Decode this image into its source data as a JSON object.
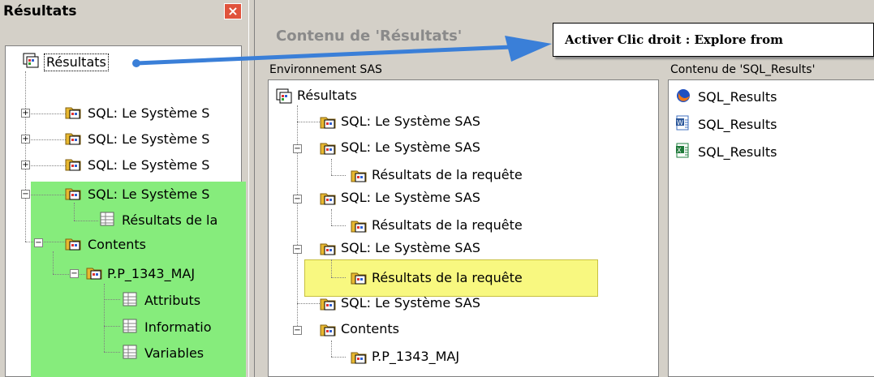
{
  "left": {
    "title": "Résultats",
    "close": "×",
    "items": [
      {
        "label": "Résultats"
      },
      {
        "label": "SQL:  Le Système S"
      },
      {
        "label": "SQL:  Le Système S"
      },
      {
        "label": "SQL:  Le Système S"
      },
      {
        "label": "SQL:  Le Système S"
      },
      {
        "label": "SQL:  Le Système S"
      },
      {
        "label": "Résultats de la"
      },
      {
        "label": "Contents"
      },
      {
        "label": "P.P_1343_MAJ"
      },
      {
        "label": "Attributs"
      },
      {
        "label": "Informatio"
      },
      {
        "label": "Variables"
      }
    ]
  },
  "right": {
    "title": "Contenu de 'Résultats'",
    "tooltip": "Activer Clic droit : Explore from",
    "env_label": "Environnement SAS",
    "contenu_label": "Contenu de 'SQL_Results'",
    "env_items": [
      {
        "label": "Résultats"
      },
      {
        "label": "SQL:  Le Système SAS"
      },
      {
        "label": "SQL:  Le Système SAS"
      },
      {
        "label": "Résultats de la requête"
      },
      {
        "label": "SQL:  Le Système SAS"
      },
      {
        "label": "Résultats de la requête"
      },
      {
        "label": "SQL:  Le Système SAS"
      },
      {
        "label": "Résultats de la requête"
      },
      {
        "label": "SQL:  Le Système SAS"
      },
      {
        "label": "Contents"
      },
      {
        "label": "P.P_1343_MAJ"
      }
    ],
    "contents": [
      {
        "label": "SQL_Results",
        "icon": "firefox-icon"
      },
      {
        "label": "SQL_Results",
        "icon": "word-icon"
      },
      {
        "label": "SQL_Results",
        "icon": "excel-icon"
      }
    ]
  },
  "colors": {
    "highlight_green": "#86ec7c",
    "highlight_yellow": "#f8f880",
    "arrow_blue": "#3a7fd8"
  },
  "icons": {
    "folder": "results-folder-icon",
    "root": "results-root-icon",
    "table": "table-icon"
  }
}
